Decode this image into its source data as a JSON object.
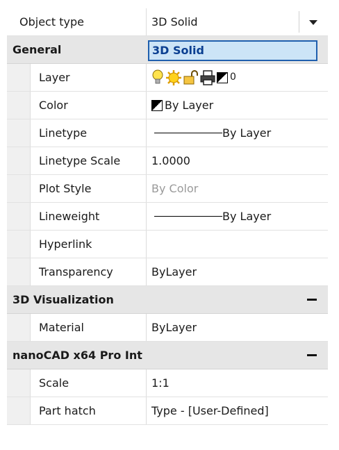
{
  "object_type": {
    "label": "Object type",
    "value": "3D Solid",
    "dropdown_option": "3D Solid"
  },
  "categories": [
    {
      "name": "General",
      "collapsible_icon": false,
      "properties": [
        {
          "name": "Layer",
          "value": "0",
          "icons": [
            "lightbulb-icon",
            "sun-icon",
            "unlock-icon",
            "printer-icon",
            "color-swatch-icon"
          ]
        },
        {
          "name": "Color",
          "value": "By Layer",
          "icons": [
            "color-swatch-icon"
          ]
        },
        {
          "name": "Linetype",
          "value": "By Layer",
          "line_sample": true
        },
        {
          "name": "Linetype Scale",
          "value": "1.0000"
        },
        {
          "name": "Plot Style",
          "value": "By Color",
          "dimmed": true
        },
        {
          "name": "Lineweight",
          "value": "By Layer",
          "line_sample": true
        },
        {
          "name": "Hyperlink",
          "value": ""
        },
        {
          "name": "Transparency",
          "value": "ByLayer"
        }
      ]
    },
    {
      "name": "3D Visualization",
      "collapsible_icon": true,
      "properties": [
        {
          "name": "Material",
          "value": "ByLayer"
        }
      ]
    },
    {
      "name": "nanoCAD x64 Pro Int",
      "collapsible_icon": true,
      "properties": [
        {
          "name": "Scale",
          "value": "1:1"
        },
        {
          "name": "Part hatch",
          "value": "Type - [User-Defined]"
        }
      ]
    }
  ],
  "colors": {
    "category_bg": "#e6e6e6",
    "selection_bg": "#cce4f7",
    "selection_border": "#1f5fae",
    "dimmed_text": "#9a9a9a"
  }
}
